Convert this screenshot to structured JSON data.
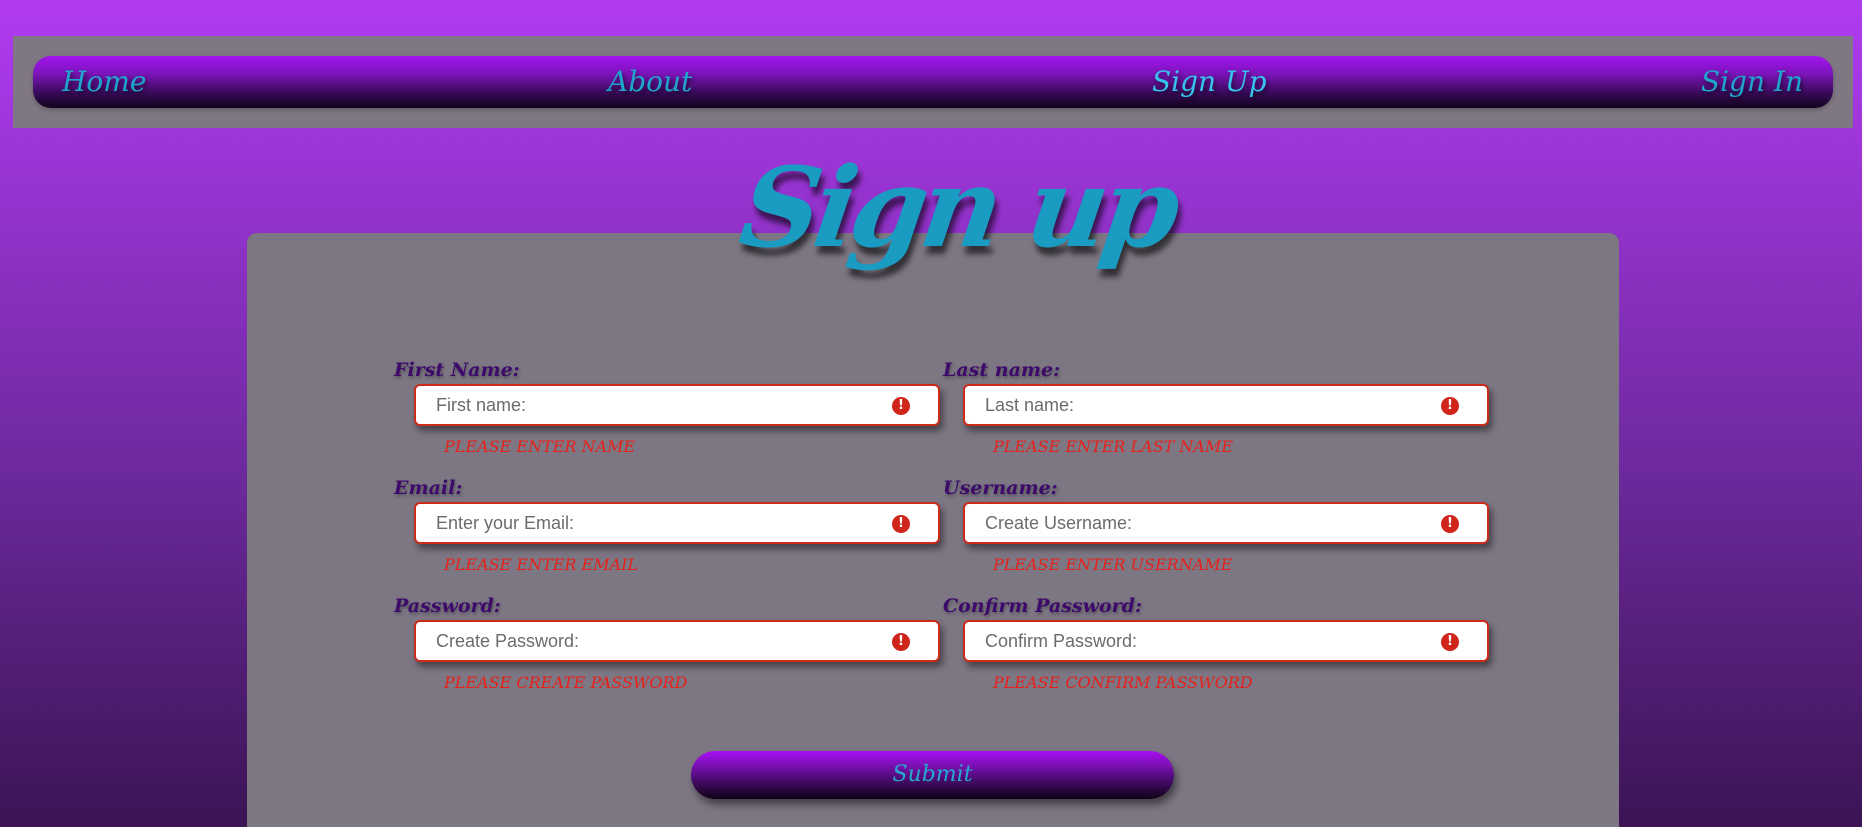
{
  "nav": {
    "items": [
      {
        "label": "Home"
      },
      {
        "label": "About"
      },
      {
        "label": "Sign Up"
      },
      {
        "label": "Sign In"
      }
    ],
    "active": "Sign Up"
  },
  "page_title": "Sign up",
  "form": {
    "fields": [
      {
        "label": "First Name:",
        "placeholder": "First name:",
        "value": "",
        "error": "Please enter name"
      },
      {
        "label": "Last name:",
        "placeholder": "Last name:",
        "value": "",
        "error": "Please enter last name"
      },
      {
        "label": "Email:",
        "placeholder": "Enter your Email:",
        "value": "",
        "error": "Please enter email"
      },
      {
        "label": "Username:",
        "placeholder": "Create Username:",
        "value": "",
        "error": "Please enter username"
      },
      {
        "label": "Password:",
        "placeholder": "Create Password:",
        "value": "",
        "error": "Please create password"
      },
      {
        "label": "Confirm Password:",
        "placeholder": "Confirm Password:",
        "value": "",
        "error": "Please confirm password"
      }
    ],
    "submit_label": "Submit"
  },
  "icons": {
    "field_status": "alert-circle-icon"
  },
  "colors": {
    "nav_text": "#1ea6cc",
    "title": "#1a9bc2",
    "error": "#e8201a",
    "label": "#3d0a6b",
    "input_border": "#cc2a1a"
  }
}
